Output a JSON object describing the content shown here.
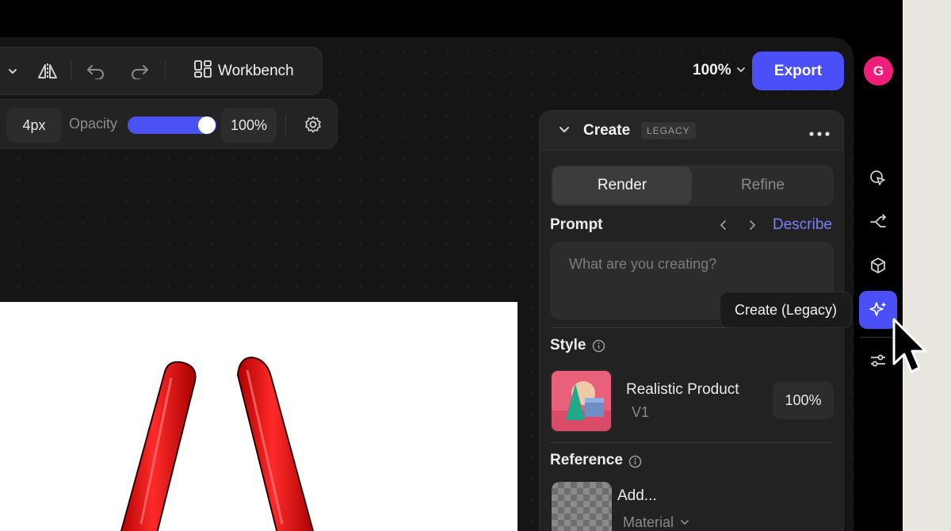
{
  "toolbar": {
    "workbench_label": "Workbench",
    "stroke_width": "4px",
    "opacity_label": "Opacity",
    "opacity_value": "100%",
    "opacity_level": 1.0
  },
  "header": {
    "zoom": "100%",
    "export_label": "Export",
    "avatar_initial": "G"
  },
  "panel": {
    "title": "Create",
    "badge": "LEGACY",
    "tabs": [
      {
        "label": "Render",
        "active": true
      },
      {
        "label": "Refine",
        "active": false
      }
    ],
    "prompt": {
      "label": "Prompt",
      "describe_link": "Describe",
      "placeholder": "What are you creating?",
      "value": ""
    },
    "style": {
      "label": "Style",
      "name": "Realistic Product",
      "version": "V1",
      "strength": "100%"
    },
    "reference": {
      "label": "Reference",
      "add_label": "Add...",
      "type_label": "Material"
    }
  },
  "rail": {
    "items": [
      {
        "icon": "pointer-click-icon"
      },
      {
        "icon": "branch-icon"
      },
      {
        "icon": "cube-icon"
      },
      {
        "icon": "sparkles-icon",
        "active": true
      },
      {
        "icon": "sliders-icon"
      }
    ],
    "tooltip": "Create (Legacy)"
  },
  "colors": {
    "accent": "#4a4ff7",
    "avatar": "#ee1f7a",
    "link": "#7b7ff8",
    "canvas_object": "#e01212"
  }
}
